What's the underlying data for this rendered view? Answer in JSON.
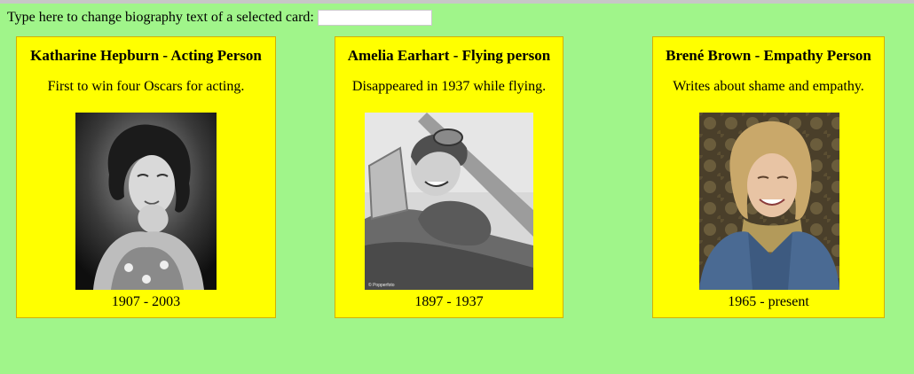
{
  "prompt": {
    "label": "Type here to change biography text of a selected card:",
    "value": "",
    "placeholder": ""
  },
  "cards": [
    {
      "name": "Katharine Hepburn - Acting Person",
      "bio": "First to win four Oscars for acting.",
      "years": "1907 - 2003",
      "photo_icon": "portrait-photo-hepburn"
    },
    {
      "name": "Amelia Earhart - Flying person",
      "bio": "Disappeared in 1937 while flying.",
      "years": "1897 - 1937",
      "photo_icon": "portrait-photo-earhart"
    },
    {
      "name": "Brené Brown - Empathy Person",
      "bio": "Writes about shame and empathy.",
      "years": "1965 - present",
      "photo_icon": "portrait-photo-brown"
    }
  ],
  "colors": {
    "background": "#a0f58a",
    "card_background": "#ffff00",
    "card_border": "#d4b000"
  }
}
